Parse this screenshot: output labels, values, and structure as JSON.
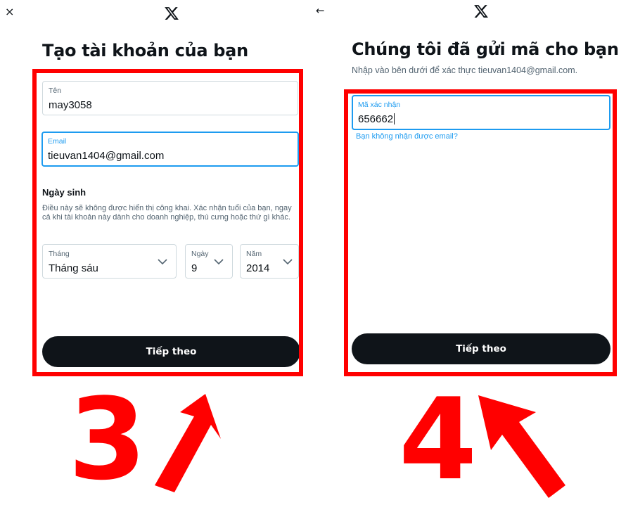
{
  "left_panel": {
    "close_icon": "×",
    "title": "Tạo tài khoản của bạn",
    "name_field": {
      "label": "Tên",
      "value": "may3058"
    },
    "email_field": {
      "label": "Email",
      "value": "tieuvan1404@gmail.com"
    },
    "birth_section": {
      "title": "Ngày sinh",
      "description": "Điều này sẽ không được hiển thị công khai.  Xác nhận tuổi của bạn, ngay cả khi tài khoản này dành cho doanh nghiệp, thú cưng hoặc thứ gì khác."
    },
    "month_select": {
      "label": "Tháng",
      "value": "Tháng sáu"
    },
    "day_select": {
      "label": "Ngày",
      "value": "9"
    },
    "year_select": {
      "label": "Năm",
      "value": "2014"
    },
    "next_button": "Tiếp theo",
    "step_number": "3"
  },
  "right_panel": {
    "back_icon": "←",
    "title": "Chúng tôi đã gửi mã cho bạn",
    "subtitle": "Nhập vào bên dưới để xác thực tieuvan1404@gmail.com.",
    "code_field": {
      "label": "Mã xác nhận",
      "value": "656662"
    },
    "resend_link": "Bạn không nhận được email?",
    "next_button": "Tiếp theo",
    "step_number": "4"
  },
  "colors": {
    "highlight": "#ff0000",
    "accent": "#1d9bf0",
    "button": "#0f1419"
  }
}
